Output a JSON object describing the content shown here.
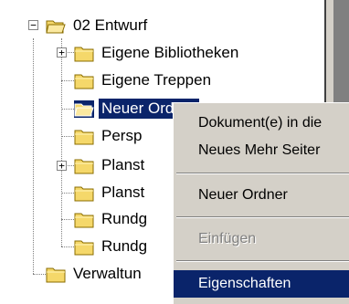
{
  "tree": {
    "root_label": "02 Entwurf",
    "items": [
      {
        "label": "Eigene Bibliotheken"
      },
      {
        "label": "Eigene Treppen"
      },
      {
        "label": "Neuer Ordner"
      },
      {
        "label": "Persp"
      },
      {
        "label": "Planst"
      },
      {
        "label": "Planst"
      },
      {
        "label": "Rundg"
      },
      {
        "label": "Rundg"
      }
    ],
    "bottom_label": "Verwaltun"
  },
  "context_menu": {
    "items": [
      {
        "label": "Dokument(e) in die"
      },
      {
        "label": "Neues Mehr Seiter"
      },
      {
        "label": "Neuer Ordner"
      },
      {
        "label": "Einfügen"
      },
      {
        "label": "Eigenschaften"
      }
    ]
  },
  "colors": {
    "selection": "#0a246a",
    "menu_bg": "#d4d0c8",
    "folder_yellow": "#f5d86a"
  }
}
